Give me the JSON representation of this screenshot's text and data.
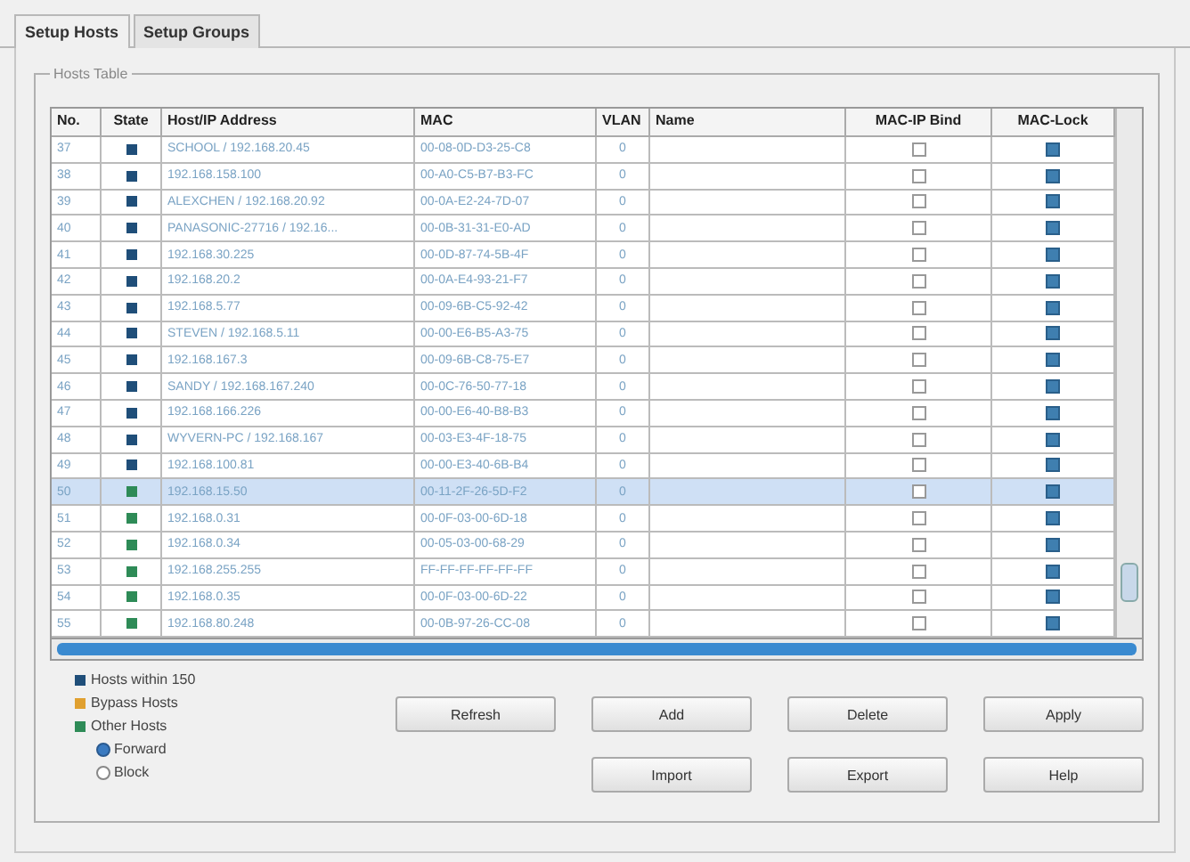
{
  "tabs": [
    {
      "label": "Setup Hosts",
      "selected": true
    },
    {
      "label": "Setup Groups",
      "selected": false
    }
  ],
  "hosts_table": {
    "title": "Hosts Table",
    "columns": [
      "No.",
      "State",
      "Host/IP Address",
      "MAC",
      "VLAN",
      "Name",
      "MAC-IP Bind",
      "MAC-Lock"
    ],
    "rows": [
      {
        "no": "37",
        "color": "#1f4e79",
        "host": "SCHOOL / 192.168.20.45",
        "mac": "00-08-0D-D3-25-C8",
        "vlan": "0",
        "mac_ip_bind": false,
        "mac_lock": true,
        "selected": false
      },
      {
        "no": "38",
        "color": "#1f4e79",
        "host": "192.168.158.100",
        "mac": "00-A0-C5-B7-B3-FC",
        "vlan": "0",
        "mac_ip_bind": false,
        "mac_lock": true,
        "selected": false
      },
      {
        "no": "39",
        "color": "#1f4e79",
        "host": "ALEXCHEN / 192.168.20.92",
        "mac": "00-0A-E2-24-7D-07",
        "vlan": "0",
        "mac_ip_bind": false,
        "mac_lock": true,
        "selected": false
      },
      {
        "no": "40",
        "color": "#1f4e79",
        "host": "PANASONIC-27716 / 192.16...",
        "mac": "00-0B-31-31-E0-AD",
        "vlan": "0",
        "mac_ip_bind": false,
        "mac_lock": true,
        "selected": false
      },
      {
        "no": "41",
        "color": "#1f4e79",
        "host": "192.168.30.225",
        "mac": "00-0D-87-74-5B-4F",
        "vlan": "0",
        "mac_ip_bind": false,
        "mac_lock": true,
        "selected": false
      },
      {
        "no": "42",
        "color": "#1f4e79",
        "host": "192.168.20.2",
        "mac": "00-0A-E4-93-21-F7",
        "vlan": "0",
        "mac_ip_bind": false,
        "mac_lock": true,
        "selected": false
      },
      {
        "no": "43",
        "color": "#1f4e79",
        "host": "192.168.5.77",
        "mac": "00-09-6B-C5-92-42",
        "vlan": "0",
        "mac_ip_bind": false,
        "mac_lock": true,
        "selected": false
      },
      {
        "no": "44",
        "color": "#1f4e79",
        "host": "STEVEN / 192.168.5.11",
        "mac": "00-00-E6-B5-A3-75",
        "vlan": "0",
        "mac_ip_bind": false,
        "mac_lock": true,
        "selected": false
      },
      {
        "no": "45",
        "color": "#1f4e79",
        "host": "192.168.167.3",
        "mac": "00-09-6B-C8-75-E7",
        "vlan": "0",
        "mac_ip_bind": false,
        "mac_lock": true,
        "selected": false
      },
      {
        "no": "46",
        "color": "#1f4e79",
        "host": "SANDY / 192.168.167.240",
        "mac": "00-0C-76-50-77-18",
        "vlan": "0",
        "mac_ip_bind": false,
        "mac_lock": true,
        "selected": false
      },
      {
        "no": "47",
        "color": "#1f4e79",
        "host": "192.168.166.226",
        "mac": "00-00-E6-40-B8-B3",
        "vlan": "0",
        "mac_ip_bind": false,
        "mac_lock": true,
        "selected": false
      },
      {
        "no": "48",
        "color": "#1f4e79",
        "host": "WYVERN-PC / 192.168.167",
        "mac": "00-03-E3-4F-18-75",
        "vlan": "0",
        "mac_ip_bind": false,
        "mac_lock": true,
        "selected": false
      },
      {
        "no": "49",
        "color": "#1f4e79",
        "host": "192.168.100.81",
        "mac": "00-00-E3-40-6B-B4",
        "vlan": "0",
        "mac_ip_bind": false,
        "mac_lock": true,
        "selected": false
      },
      {
        "no": "50",
        "color": "#2e8b57",
        "host": "192.168.15.50",
        "mac": "00-11-2F-26-5D-F2",
        "vlan": "0",
        "mac_ip_bind": false,
        "mac_lock": true,
        "selected": true
      },
      {
        "no": "51",
        "color": "#2e8b57",
        "host": "192.168.0.31",
        "mac": "00-0F-03-00-6D-18",
        "vlan": "0",
        "mac_ip_bind": false,
        "mac_lock": true,
        "selected": false
      },
      {
        "no": "52",
        "color": "#2e8b57",
        "host": "192.168.0.34",
        "mac": "00-05-03-00-68-29",
        "vlan": "0",
        "mac_ip_bind": false,
        "mac_lock": true,
        "selected": false
      },
      {
        "no": "53",
        "color": "#2e8b57",
        "host": "192.168.255.255",
        "mac": "FF-FF-FF-FF-FF-FF",
        "vlan": "0",
        "mac_ip_bind": false,
        "mac_lock": true,
        "selected": false
      },
      {
        "no": "54",
        "color": "#2e8b57",
        "host": "192.168.0.35",
        "mac": "00-0F-03-00-6D-22",
        "vlan": "0",
        "mac_ip_bind": false,
        "mac_lock": true,
        "selected": false
      },
      {
        "no": "55",
        "color": "#2e8b57",
        "host": "192.168.80.248",
        "mac": "00-0B-97-26-CC-08",
        "vlan": "0",
        "mac_ip_bind": false,
        "mac_lock": true,
        "selected": false
      }
    ]
  },
  "legend": [
    {
      "label": "Hosts within 150",
      "color": "#1f4e79"
    },
    {
      "label": "Bypass Hosts",
      "color": "#e0a030"
    },
    {
      "label": "Other Hosts",
      "color": "#2e8b57"
    }
  ],
  "other_hosts_action": [
    {
      "label": "Forward",
      "selected": true
    },
    {
      "label": "Block",
      "selected": false
    }
  ],
  "buttons": [
    [
      "Refresh",
      "Add",
      "Delete",
      "Apply"
    ],
    [
      "Import",
      "Export",
      "Help"
    ]
  ]
}
